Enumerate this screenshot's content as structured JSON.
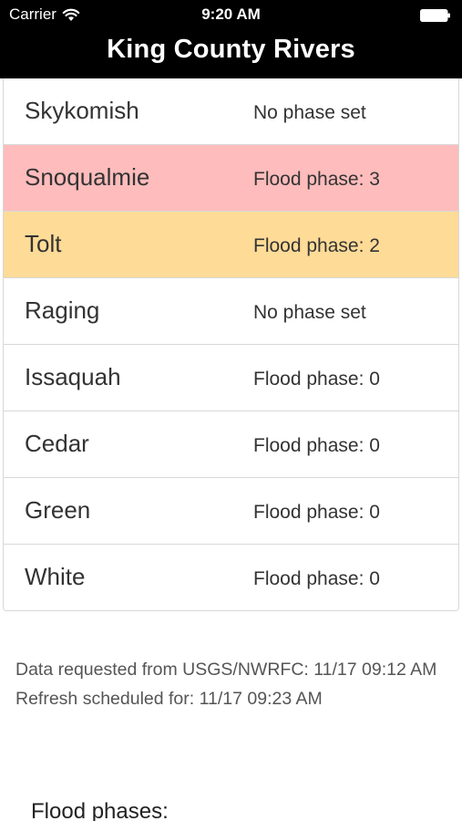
{
  "status_bar": {
    "carrier": "Carrier",
    "time": "9:20 AM",
    "wifi_icon": "wifi-icon",
    "battery_icon": "battery-icon"
  },
  "header": {
    "title": "King County Rivers"
  },
  "colors": {
    "phase_3": "#ffbcbc",
    "phase_2": "#fedb97",
    "default": "#ffffff"
  },
  "rivers": [
    {
      "name": "Skykomish",
      "status": "No phase set"
    },
    {
      "name": "Snoqualmie",
      "status": "Flood phase: 3"
    },
    {
      "name": "Tolt",
      "status": "Flood phase: 2"
    },
    {
      "name": "Raging",
      "status": "No phase set"
    },
    {
      "name": "Issaquah",
      "status": "Flood phase: 0"
    },
    {
      "name": "Cedar",
      "status": "Flood phase: 0"
    },
    {
      "name": "Green",
      "status": "Flood phase: 0"
    },
    {
      "name": "White",
      "status": "Flood phase: 0"
    }
  ],
  "footer": {
    "requested": "Data requested from USGS/NWRFC: 11/17 09:12 AM",
    "refresh": "Refresh scheduled for: 11/17 09:23 AM"
  },
  "legend": {
    "heading": "Flood phases:"
  }
}
